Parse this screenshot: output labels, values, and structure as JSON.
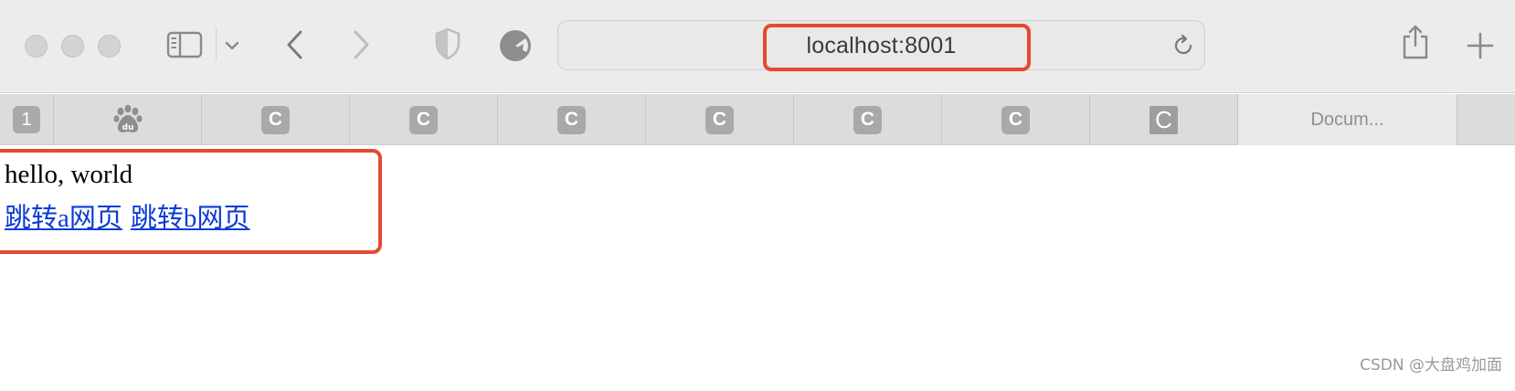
{
  "browser": {
    "url": "localhost:8001",
    "icons": {
      "sidebar": "sidebar-icon",
      "dropdown": "chevron-down-icon",
      "back": "back-icon",
      "forward": "forward-icon",
      "privacy": "shield-icon",
      "extension": "extension-icon",
      "reload": "reload-icon",
      "share": "share-icon",
      "new_tab": "plus-icon"
    }
  },
  "tabs": [
    {
      "favicon": "1"
    },
    {
      "favicon": "baidu-paw-icon"
    },
    {
      "favicon": "C"
    },
    {
      "favicon": "C"
    },
    {
      "favicon": "C"
    },
    {
      "favicon": "C"
    },
    {
      "favicon": "C"
    },
    {
      "favicon": "C"
    },
    {
      "favicon": "C"
    },
    {
      "title": "Docum..."
    }
  ],
  "page": {
    "heading": "hello, world",
    "link_a": "跳转a网页",
    "link_b": "跳转b网页"
  },
  "watermark": "CSDN @大盘鸡加面",
  "colors": {
    "highlight": "#e34a33",
    "link": "#0b3bd6"
  }
}
